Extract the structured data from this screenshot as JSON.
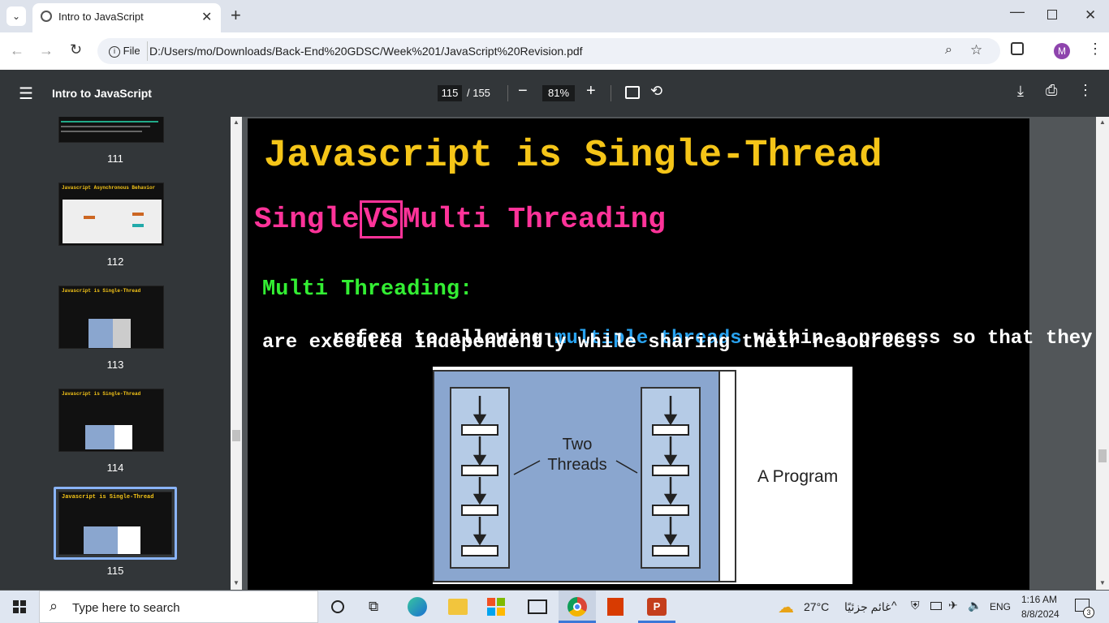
{
  "browser": {
    "tab_title": "Intro to JavaScript",
    "new_tab": "+",
    "file_chip": "File",
    "url": "D:/Users/mo/Downloads/Back-End%20GDSC/Week%201/JavaScript%20Revision.pdf",
    "profile_initial": "M"
  },
  "pdf": {
    "title": "Intro to JavaScript",
    "page_current": "115",
    "page_total": "/ 155",
    "zoom": "81%"
  },
  "thumbnails": [
    {
      "num": "111",
      "title": ""
    },
    {
      "num": "112",
      "title": "Javascript Asynchronous Behavior"
    },
    {
      "num": "113",
      "title": "Javascript is Single-Thread"
    },
    {
      "num": "114",
      "title": "Javascript is Single-Thread"
    },
    {
      "num": "115",
      "title": "Javascript is Single-Thread"
    }
  ],
  "slide": {
    "title": "Javascript is Single-Thread",
    "sub_left": "Single",
    "sub_vs": "VS",
    "sub_right": "Multi Threading",
    "heading": "Multi Threading:",
    "line1_a": "refers to allowing ",
    "line1_hl": "multiple threads",
    "line1_b": " within a process so that they",
    "line2": "are executed independently while sharing their resources.",
    "diagram_threads": "Two\nThreads",
    "diagram_program": "A Program"
  },
  "taskbar": {
    "search_placeholder": "Type here to search",
    "weather_temp": "27°C",
    "weather_text": "غائم جزئيًا",
    "lang": "ENG",
    "time": "1:16 AM",
    "date": "8/8/2024",
    "notifications": "3"
  },
  "colors": {
    "title_yellow": "#f5c518",
    "pink": "#ff3399",
    "green": "#33ee33",
    "blue": "#29a3f0",
    "diagram_blue": "#8aa6cf"
  }
}
